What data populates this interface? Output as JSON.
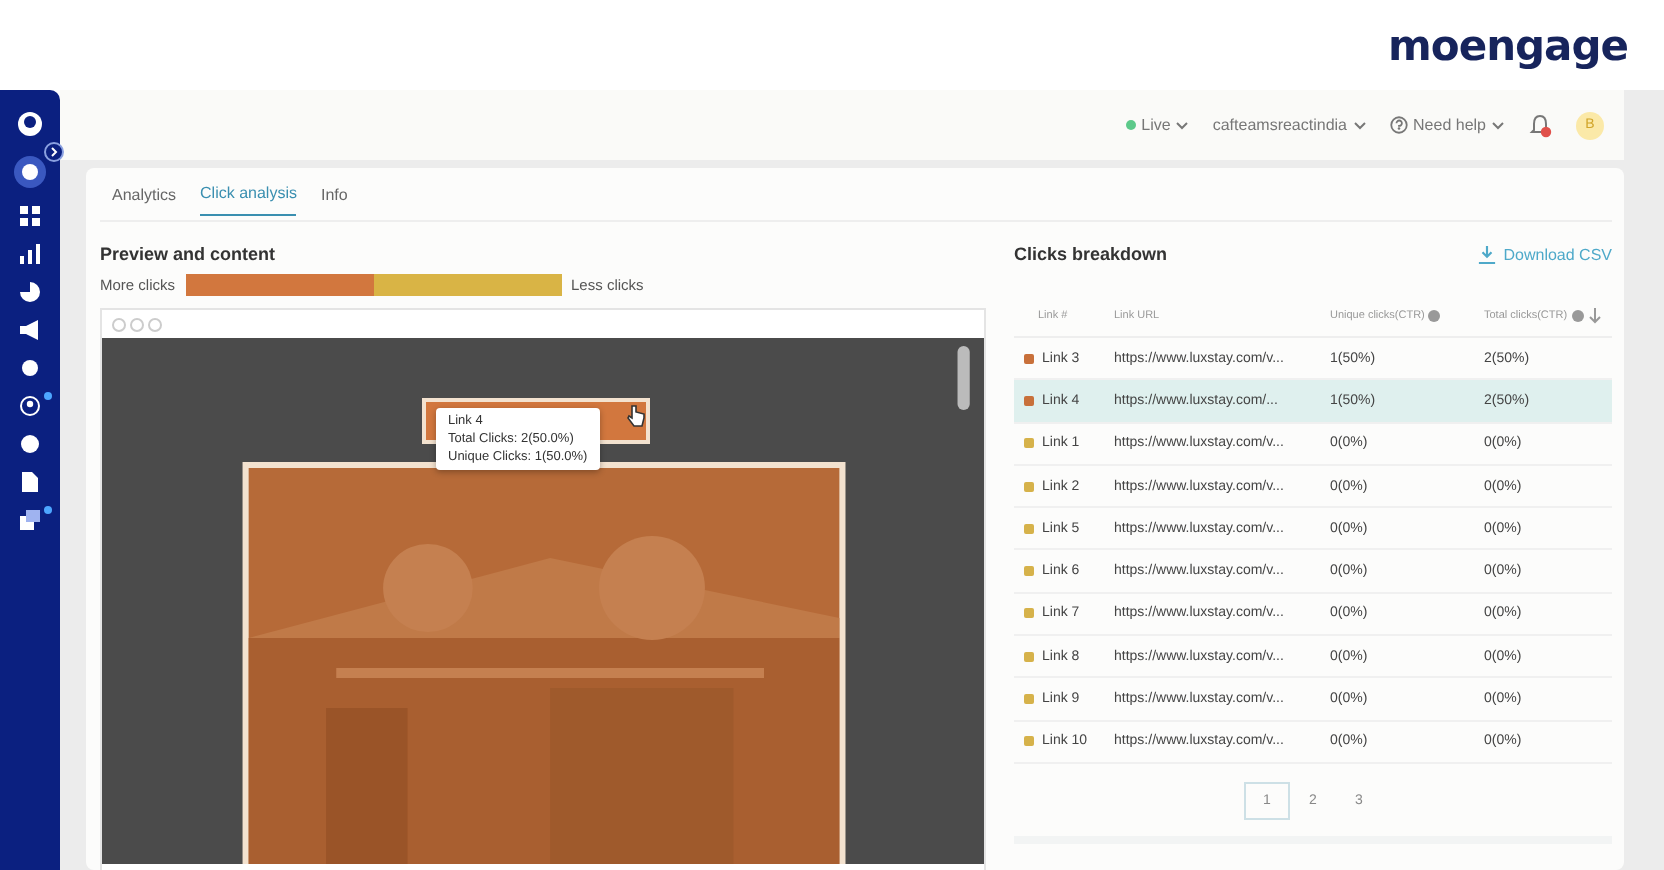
{
  "brand": {
    "logo": "moengage"
  },
  "header": {
    "status": "Live",
    "workspace": "cafteamsreactindia",
    "help": "Need help",
    "avatar": "B"
  },
  "tabs": [
    {
      "label": "Analytics",
      "selected": false
    },
    {
      "label": "Click analysis",
      "selected": true
    },
    {
      "label": "Info",
      "selected": false
    }
  ],
  "preview": {
    "title": "Preview and content",
    "scale_more": "More clicks",
    "scale_less": "Less clicks",
    "tooltip": {
      "title": "Link 4",
      "total": "Total Clicks: 2(50.0%)",
      "unique": "Unique Clicks: 1(50.0%)"
    }
  },
  "breakdown": {
    "title": "Clicks breakdown",
    "download": "Download CSV",
    "columns": [
      "Link #",
      "Link URL",
      "Unique clicks(CTR)",
      "Total clicks(CTR)"
    ],
    "rows": [
      {
        "link": "Link 3",
        "url": "https://www.luxstay.com/v...",
        "unique": "1(50%)",
        "total": "2(50%)",
        "color": "#c8703a",
        "selected": false
      },
      {
        "link": "Link 4",
        "url": "https://www.luxstay.com/...",
        "unique": "1(50%)",
        "total": "2(50%)",
        "color": "#c8703a",
        "selected": true
      },
      {
        "link": "Link 1",
        "url": "https://www.luxstay.com/v...",
        "unique": "0(0%)",
        "total": "0(0%)",
        "color": "#d6b24a",
        "selected": false
      },
      {
        "link": "Link 2",
        "url": "https://www.luxstay.com/v...",
        "unique": "0(0%)",
        "total": "0(0%)",
        "color": "#d6b24a",
        "selected": false
      },
      {
        "link": "Link 5",
        "url": "https://www.luxstay.com/v...",
        "unique": "0(0%)",
        "total": "0(0%)",
        "color": "#d6b24a",
        "selected": false
      },
      {
        "link": "Link 6",
        "url": "https://www.luxstay.com/v...",
        "unique": "0(0%)",
        "total": "0(0%)",
        "color": "#d6b24a",
        "selected": false
      },
      {
        "link": "Link 7",
        "url": "https://www.luxstay.com/v...",
        "unique": "0(0%)",
        "total": "0(0%)",
        "color": "#d6b24a",
        "selected": false
      },
      {
        "link": "Link 8",
        "url": "https://www.luxstay.com/v...",
        "unique": "0(0%)",
        "total": "0(0%)",
        "color": "#d6b24a",
        "selected": false
      },
      {
        "link": "Link 9",
        "url": "https://www.luxstay.com/v...",
        "unique": "0(0%)",
        "total": "0(0%)",
        "color": "#d6b24a",
        "selected": false
      },
      {
        "link": "Link 10",
        "url": "https://www.luxstay.com/v...",
        "unique": "0(0%)",
        "total": "0(0%)",
        "color": "#d6b24a",
        "selected": false
      }
    ],
    "pages": [
      {
        "label": "1",
        "selected": true
      },
      {
        "label": "2",
        "selected": false
      },
      {
        "label": "3",
        "selected": false
      }
    ]
  }
}
